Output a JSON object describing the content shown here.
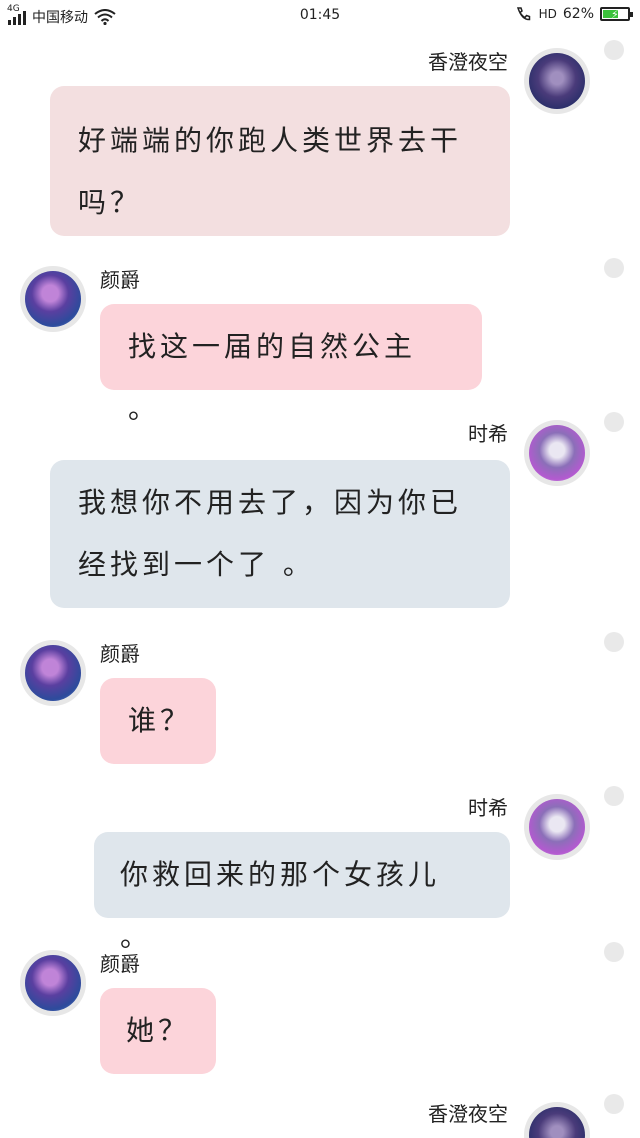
{
  "status_bar": {
    "network": "4G",
    "carrier": "中国移动",
    "time": "01:45",
    "hd": "HD",
    "battery_percent": "62%",
    "battery_level": 0.62,
    "icons": [
      "signal-icon",
      "wifi-icon",
      "call-hd-icon",
      "battery-charging-icon"
    ]
  },
  "colors": {
    "bubble_tan": "#f3dfe0",
    "bubble_pink": "#fcd4da",
    "bubble_blue": "#dfe6ec",
    "battery_green": "#3cc23c"
  },
  "messages": [
    {
      "sender": "香澄夜空",
      "side": "right",
      "text_lines": [
        "好端端的你跑人类世界去干",
        "吗？"
      ]
    },
    {
      "sender": "颜爵",
      "side": "left",
      "text_lines": [
        "找这一届的自然公主 。"
      ]
    },
    {
      "sender": "时希",
      "side": "right",
      "text_lines": [
        "我想你不用去了，因为你已",
        "经找到一个了 。"
      ]
    },
    {
      "sender": "颜爵",
      "side": "left",
      "text_lines": [
        "谁？"
      ]
    },
    {
      "sender": "时希",
      "side": "right",
      "text_lines": [
        "你救回来的那个女孩儿 。"
      ]
    },
    {
      "sender": "颜爵",
      "side": "left",
      "text_lines": [
        "她？"
      ]
    },
    {
      "sender": "香澄夜空",
      "side": "right",
      "text_lines": []
    }
  ]
}
